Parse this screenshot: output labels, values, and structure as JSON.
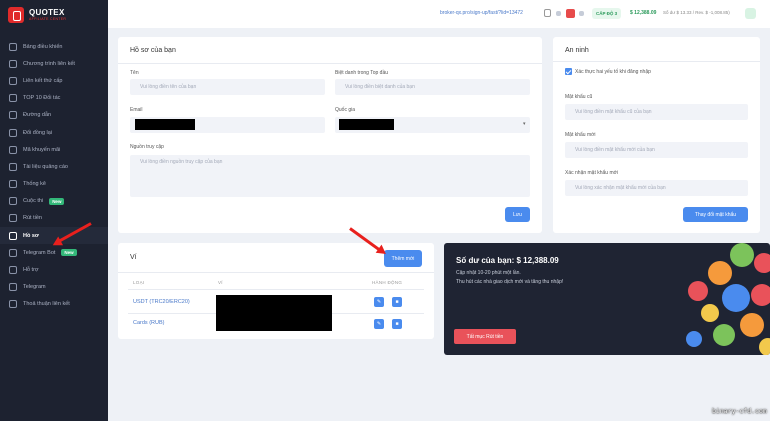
{
  "brand": {
    "name": "QUOTEX",
    "sub": "AFFILIATE CENTER"
  },
  "sidebar": {
    "items": [
      {
        "label": "Bảng điều khiển",
        "icon": "dashboard-icon"
      },
      {
        "label": "Chương trình liên kết",
        "icon": "program-icon"
      },
      {
        "label": "Liên kết thứ cấp",
        "icon": "link-icon"
      },
      {
        "label": "TOP 10 Đối tác",
        "icon": "chart-icon"
      },
      {
        "label": "Đường dẫn",
        "icon": "path-icon"
      },
      {
        "label": "Đổi đồng lại",
        "icon": "exchange-icon"
      },
      {
        "label": "Mã khuyến mãi",
        "icon": "promo-icon"
      },
      {
        "label": "Tài liệu quảng cáo",
        "icon": "document-icon"
      },
      {
        "label": "Thống kê",
        "icon": "stats-icon"
      },
      {
        "label": "Cuộc thi",
        "icon": "contest-icon",
        "badge": "New"
      },
      {
        "label": "Rút tiền",
        "icon": "withdraw-icon"
      },
      {
        "label": "Hồ sơ",
        "icon": "profile-icon",
        "active": true
      },
      {
        "label": "Telegram Bot",
        "icon": "telegram-bot-icon",
        "badge": "New"
      },
      {
        "label": "Hỗ trợ",
        "icon": "support-icon"
      },
      {
        "label": "Telegram",
        "icon": "telegram-icon"
      },
      {
        "label": "Thoả thuận liên kết",
        "icon": "agreement-icon"
      }
    ]
  },
  "topbar": {
    "link": "broker-qx.pro/sign-up/fast/?lid=13472",
    "level": "CẤP ĐỘ 3",
    "balance": "$ 12,388.09",
    "revenue": "Số dư $ 13.33 / Rev. $ -1,008.85)"
  },
  "profile": {
    "title": "Hồ sơ của bạn",
    "name_label": "Tên",
    "name_placeholder": "Vui lòng điền tên của bạn",
    "nickname_label": "Biệt danh trong Top đầu",
    "nickname_placeholder": "Vui lòng điền biệt danh của bạn",
    "email_label": "Email",
    "country_label": "Quốc gia",
    "traffic_label": "Nguồn truy cập",
    "traffic_placeholder": "Vui lòng điền nguồn truy cập của bạn",
    "save": "Lưu"
  },
  "security": {
    "title": "An ninh",
    "twofa_label": "Xác thực hai yếu tố khi đăng nhập",
    "old_label": "Mật khẩu cũ",
    "old_placeholder": "Vui lòng điền mật khẩu cũ của bạn",
    "new_label": "Mật khẩu mới",
    "new_placeholder": "Vui lòng điền mật khẩu mới của bạn",
    "confirm_label": "Xác nhận mật khẩu mới",
    "confirm_placeholder": "Vui lòng xác nhận mật khẩu mới của bạn",
    "change": "Thay đổi mật khẩu"
  },
  "wallet": {
    "title": "Ví",
    "add": "Thêm mới",
    "col_type": "LOẠI",
    "col_wallet": "VÍ",
    "col_action": "HÀNH ĐỘNG",
    "rows": [
      {
        "type": "USDT (TRC20/ERC20)"
      },
      {
        "type": "Cards (RUB)"
      }
    ]
  },
  "promo": {
    "title": "Số dư của bạn: $ 12,388.09",
    "line1": "Cập nhật 10-20 phút một lần.",
    "line2": "Thu hút các nhà giao dịch mới và tăng thu nhập!",
    "button": "Tất mục Rút tiền"
  },
  "watermark": "binary-cfd.com",
  "colors": {
    "accent": "#4a8bee",
    "sidebar": "#1d2230",
    "success": "#2b9a5b",
    "danger": "#e9525a"
  }
}
